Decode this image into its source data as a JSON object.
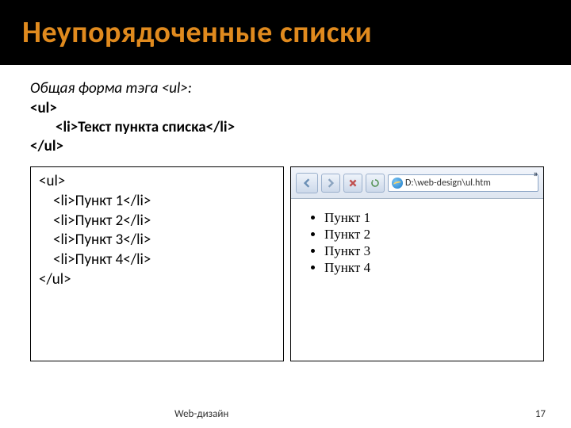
{
  "title": "Неупорядоченные списки",
  "intro": "Общая форма тэга <ul>:",
  "general_code": {
    "open": "<ul>",
    "li": "<li>Текст пункта списка</li>",
    "close": "</ul>"
  },
  "example_code": {
    "open": "<ul>",
    "l1": "<li>Пункт 1</li>",
    "l2": "<li>Пункт 2</li>",
    "l3": "<li>Пункт 3</li>",
    "l4": "<li>Пункт 4</li>",
    "close": "</ul>"
  },
  "browser": {
    "address": "D:\\web-design\\ul.htm",
    "chevrons": "»",
    "items": [
      "Пункт 1",
      "Пункт 2",
      "Пункт 3",
      "Пункт 4"
    ]
  },
  "footer": {
    "label": "Web-дизайн",
    "page": "17"
  }
}
